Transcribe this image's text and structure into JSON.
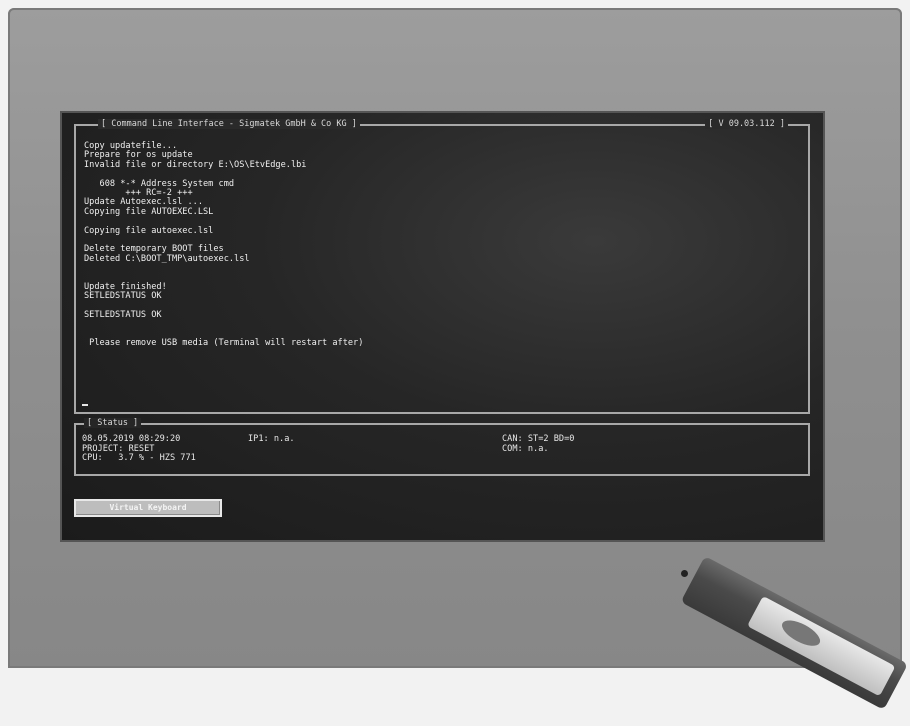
{
  "cli": {
    "title": "[ Command Line Interface - Sigmatek GmbH & Co KG ]",
    "version": "[ V 09.03.112 ]",
    "lines": [
      "Copy updatefile...",
      "Prepare for os update",
      "Invalid file or directory E:\\OS\\EtvEdge.lbi",
      "",
      "   608 *-* Address System cmd",
      "        +++ RC=-2 +++",
      "Update Autoexec.lsl ...",
      "Copying file AUTOEXEC.LSL",
      "",
      "Copying file autoexec.lsl",
      "",
      "Delete temporary BOOT files",
      "Deleted C:\\BOOT_TMP\\autoexec.lsl",
      "",
      "",
      "Update finished!",
      "SETLEDSTATUS OK",
      "",
      "SETLEDSTATUS OK",
      "",
      "",
      " Please remove USB media (Terminal will restart after)"
    ]
  },
  "status": {
    "title": "[ Status ]",
    "datetime": "08.05.2019 08:29:20",
    "project": "PROJECT: RESET",
    "cpu": "CPU:   3.7 % - HZS 771",
    "ip": "IP1: n.a.",
    "can": "CAN: ST=2 BD=0",
    "com": "COM: n.a."
  },
  "buttons": {
    "virtual_keyboard": "Virtual Keyboard"
  }
}
